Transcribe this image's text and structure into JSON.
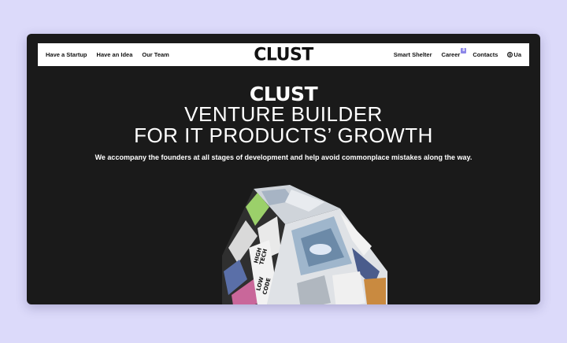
{
  "nav": {
    "left_items": [
      "Have a Startup",
      "Have an Idea",
      "Our Team"
    ],
    "logo": "CLUST",
    "right": {
      "smart_shelter": "Smart Shelter",
      "career": "Career",
      "career_badge": "8",
      "contacts": "Contacts",
      "language": "Ua"
    }
  },
  "hero": {
    "brand": "CLUST",
    "title_line1": "VENTURE BUILDER",
    "title_line2": "FOR IT PRODUCTS’ GROWTH",
    "subtitle": "We accompany the founders at all stages of development and help avoid commonplace mistakes along the way.",
    "cube_labels": [
      "HIGH",
      "TECH",
      "LOW",
      "CODE"
    ]
  },
  "colors": {
    "background": "#dcdafa",
    "window": "#1a1a1a",
    "accent": "#8c86e8"
  }
}
